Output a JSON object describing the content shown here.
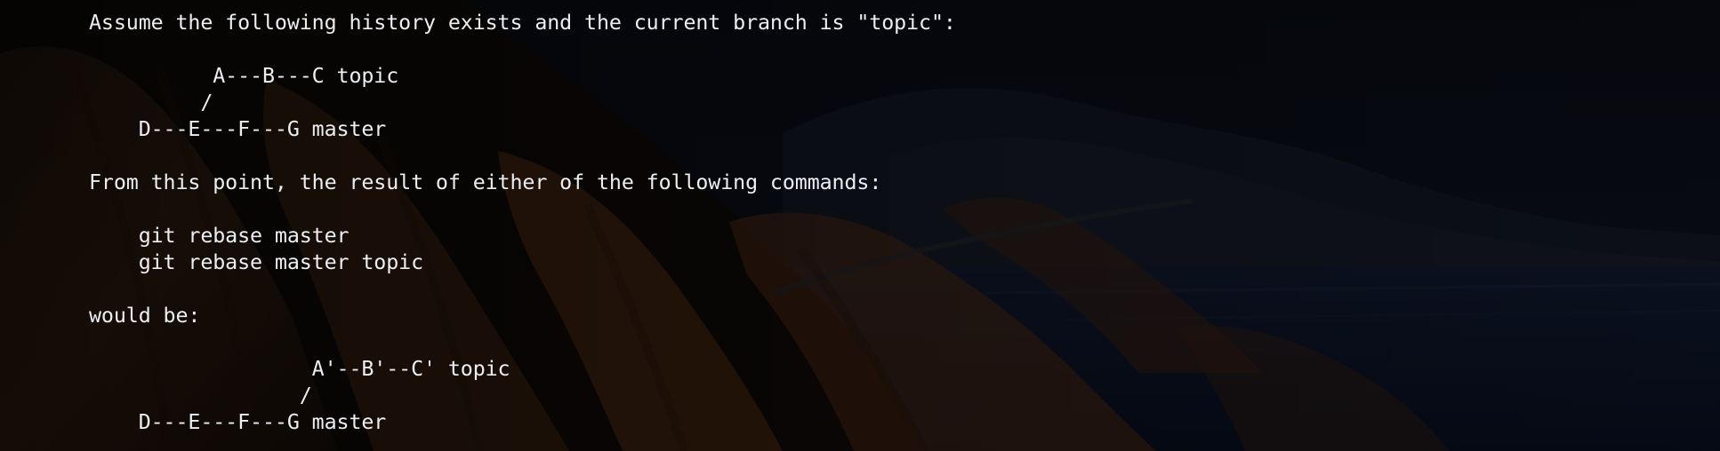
{
  "terminal": {
    "lines": [
      "Assume the following history exists and the current branch is \"topic\":",
      "",
      "          A---B---C topic",
      "         /",
      "    D---E---F---G master",
      "",
      "From this point, the result of either of the following commands:",
      "",
      "    git rebase master",
      "    git rebase master topic",
      "",
      "would be:",
      "",
      "                  A'--B'--C' topic",
      "                 /",
      "    D---E---F---G master"
    ]
  },
  "colors": {
    "text": "#eceef2",
    "background": "#06070b",
    "cliff_orange": "#7a3f1a",
    "sea_navy": "#0f1a33"
  }
}
